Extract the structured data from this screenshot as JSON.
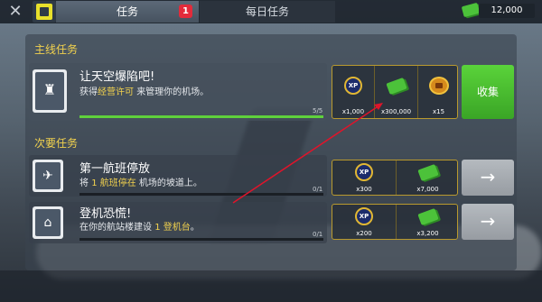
{
  "tabs": [
    {
      "label": "任务",
      "badge": "1",
      "active": true
    },
    {
      "label": "每日任务",
      "active": false
    }
  ],
  "currency": {
    "amount": "12,000",
    "icon": "cash-icon"
  },
  "sections": {
    "main": "主线任务",
    "side": "次要任务"
  },
  "main_mission": {
    "title": "让天空爆陷吧!",
    "subtitle_pre": "获得",
    "subtitle_highlight": "经营许可",
    "subtitle_post": "来管理你的机场。",
    "progress": "5/5",
    "progress_fraction": 1.0,
    "rewards": [
      {
        "icon": "xp-icon",
        "label": "XP",
        "value": "x1,000"
      },
      {
        "icon": "money-icon",
        "value": "x300,000"
      },
      {
        "icon": "wings-badge-icon",
        "value": "x15"
      }
    ],
    "button": "收集"
  },
  "side_missions": [
    {
      "title": "第一航班停放",
      "subtitle_pre": "将",
      "subtitle_highlight": "1 航班停在",
      "subtitle_post": "机场的坡道上。",
      "progress": "0/1",
      "progress_fraction": 0,
      "rewards": [
        {
          "icon": "xp-icon",
          "label": "XP",
          "value": "x300"
        },
        {
          "icon": "money-icon",
          "value": "x7,000"
        }
      ],
      "button": "→"
    },
    {
      "title": "登机恐慌!",
      "subtitle_pre": "在你的航站楼建设",
      "subtitle_highlight": "1 登机台",
      "subtitle_post": "。",
      "progress": "0/1",
      "progress_fraction": 0,
      "rewards": [
        {
          "icon": "xp-icon",
          "label": "XP",
          "value": "x200"
        },
        {
          "icon": "money-icon",
          "value": "x3,200"
        }
      ],
      "button": "→"
    }
  ],
  "colors": {
    "accent": "#f2d24e",
    "collect": "#4cc23a",
    "badge": "#e32b3b",
    "annotation": "#e0142a"
  }
}
